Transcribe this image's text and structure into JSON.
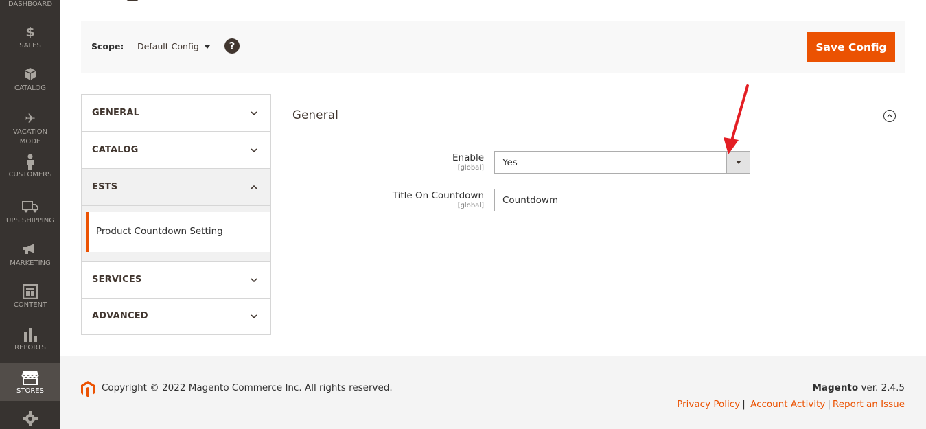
{
  "sidebar": {
    "items": [
      {
        "label": "DASHBOARD",
        "icon": "dashboard-icon"
      },
      {
        "label": "SALES",
        "icon": "dollar-icon"
      },
      {
        "label": "CATALOG",
        "icon": "cube-icon"
      },
      {
        "label": "VACATION MODE",
        "icon": "plane-icon"
      },
      {
        "label": "CUSTOMERS",
        "icon": "person-icon"
      },
      {
        "label": "UPS SHIPPING",
        "icon": "truck-icon"
      },
      {
        "label": "MARKETING",
        "icon": "megaphone-icon"
      },
      {
        "label": "CONTENT",
        "icon": "layout-icon"
      },
      {
        "label": "REPORTS",
        "icon": "bar-chart-icon"
      },
      {
        "label": "STORES",
        "icon": "store-icon",
        "active": true
      },
      {
        "label": "",
        "icon": "gear-icon"
      }
    ]
  },
  "scope": {
    "label": "Scope:",
    "value": "Default Config",
    "help": "?"
  },
  "toolbar": {
    "save_label": "Save Config"
  },
  "tabs": {
    "general": "GENERAL",
    "catalog": "CATALOG",
    "ests": "ESTS",
    "ests_item": "Product Countdown Setting",
    "services": "SERVICES",
    "advanced": "ADVANCED"
  },
  "section": {
    "title": "General",
    "fields": {
      "enable": {
        "label": "Enable",
        "scope": "[global]",
        "value": "Yes"
      },
      "title": {
        "label": "Title On Countdown",
        "scope": "[global]",
        "value": "Countdowm"
      }
    }
  },
  "footer": {
    "copyright": "Copyright © 2022 Magento Commerce Inc. All rights reserved.",
    "brand": "Magento",
    "version": " ver. 2.4.5",
    "links": {
      "privacy": "Privacy Policy",
      "activity": " Account Activity",
      "report": "Report an Issue"
    },
    "separator": "|"
  },
  "colors": {
    "accent": "#eb5202",
    "sidebar_bg": "#373330",
    "annotation_arrow": "#e31e24"
  }
}
